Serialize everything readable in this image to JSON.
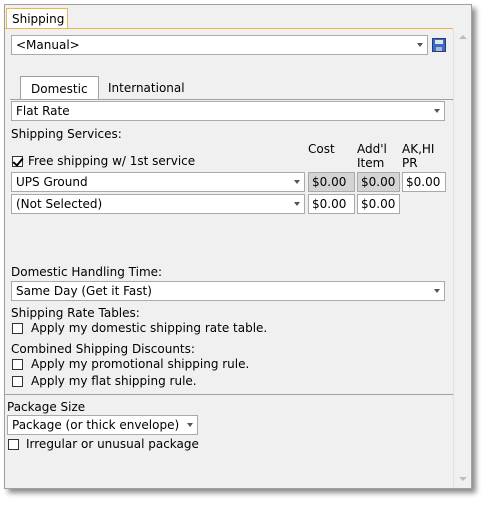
{
  "tab_title": "Shipping",
  "profile_select": {
    "value": "<Manual>"
  },
  "tabs": [
    {
      "label": "Domestic",
      "active": true
    },
    {
      "label": "International",
      "active": false
    }
  ],
  "domestic": {
    "rate_type": {
      "value": "Flat Rate"
    },
    "services_label": "Shipping Services:",
    "columns": {
      "cost": "Cost",
      "addl_1": "Add'l",
      "addl_2": "Item",
      "surcharge_1": "AK,HI",
      "surcharge_2": "PR"
    },
    "free_shipping": {
      "label": "Free shipping w/ 1st service",
      "checked": true
    },
    "services": [
      {
        "name": "UPS Ground",
        "cost": "$0.00",
        "addl": "$0.00",
        "surcharge": "$0.00",
        "cost_disabled": true
      },
      {
        "name": "(Not Selected)",
        "cost": "$0.00",
        "addl": "$0.00",
        "surcharge": "",
        "cost_disabled": false
      }
    ],
    "handling_label": "Domestic Handling Time:",
    "handling_value": "Same Day (Get it Fast)",
    "rate_tables_label": "Shipping Rate Tables:",
    "rate_table_option": {
      "label": "Apply my domestic shipping rate table.",
      "checked": false
    },
    "discounts_label": "Combined Shipping Discounts:",
    "promo_rule": {
      "label": "Apply my promotional shipping rule.",
      "checked": false
    },
    "flat_rule": {
      "label": "Apply my flat shipping rule.",
      "checked": false
    }
  },
  "package": {
    "label": "Package Size",
    "value": "Package (or thick envelope)",
    "irregular": {
      "label": "Irregular or unusual package",
      "checked": false
    }
  },
  "icons": {
    "save": "save-icon",
    "dropdown": "chevron-down-icon",
    "checkmark": "check-icon"
  },
  "colors": {
    "tab_border": "#e8b84b",
    "panel_bg": "#f0f0f0",
    "disabled_field": "#d4d4d4"
  }
}
